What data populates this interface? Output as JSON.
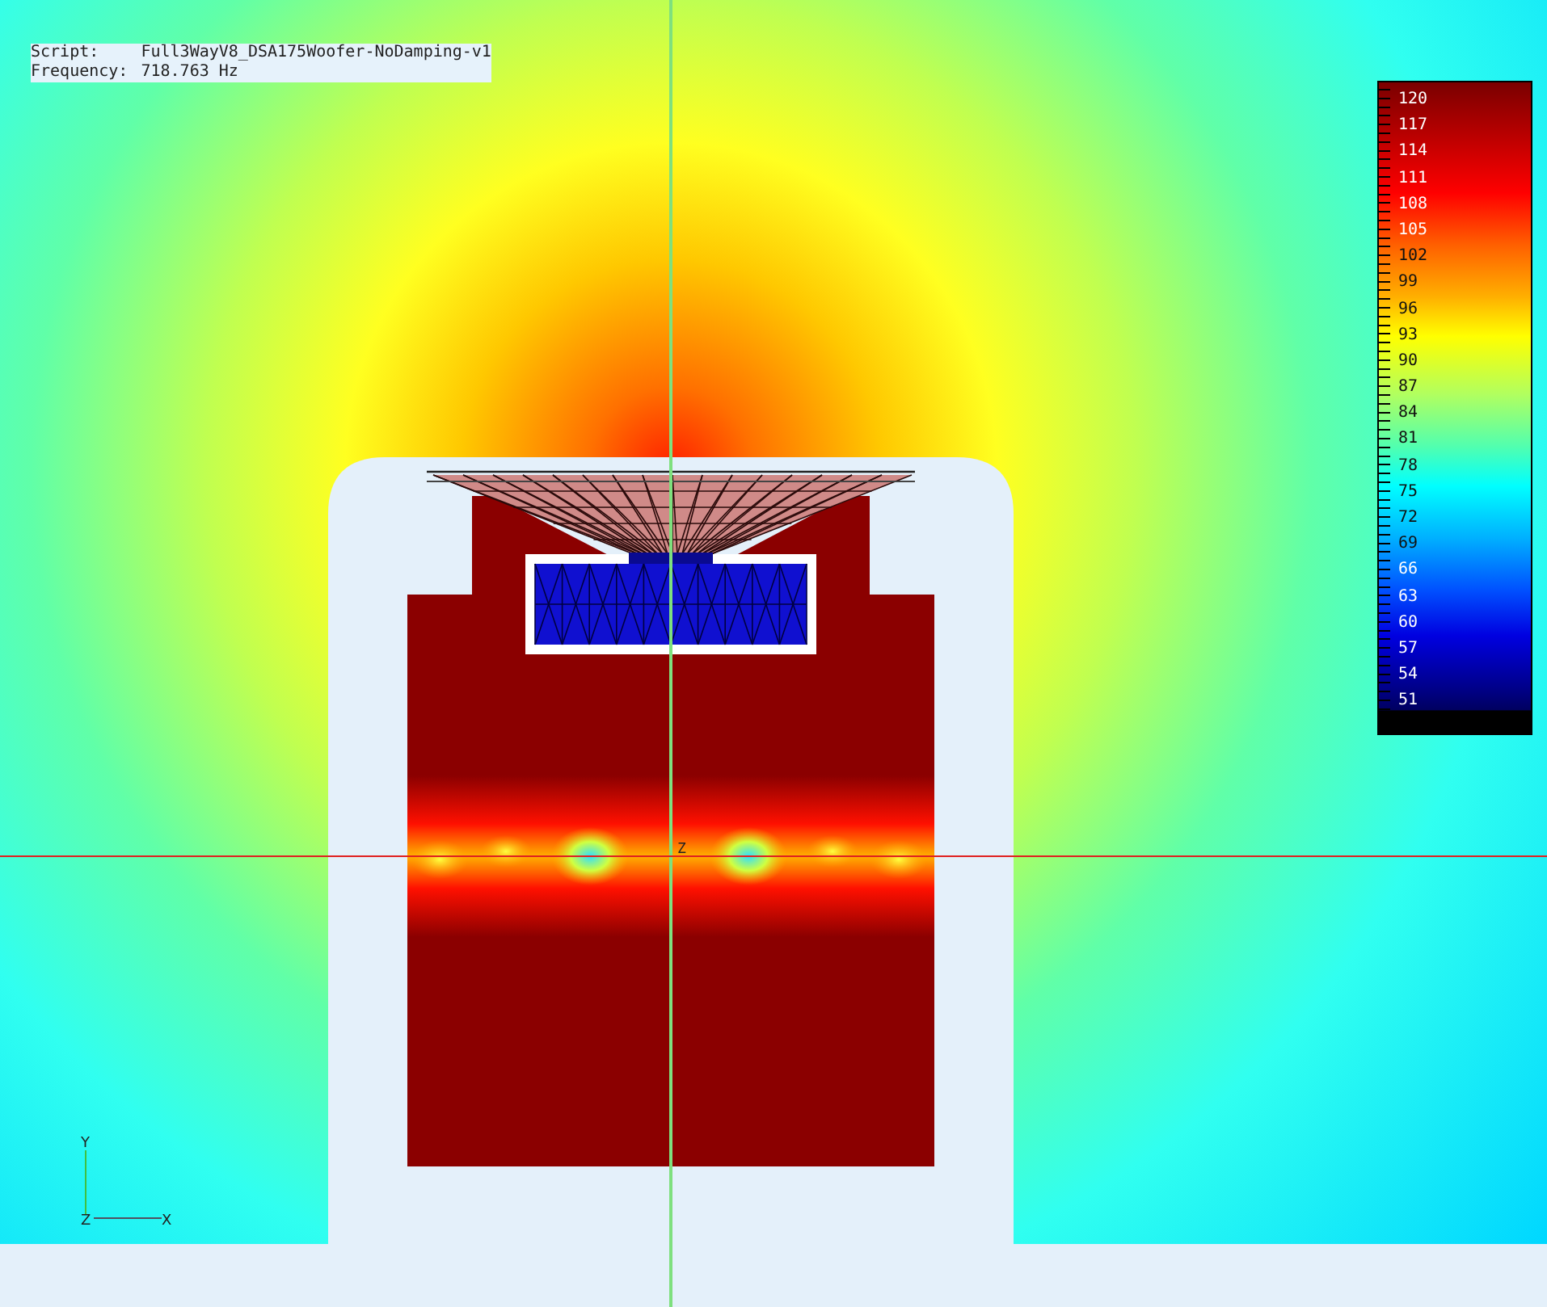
{
  "info": [
    {
      "label": "Script:",
      "value": "Full3WayV8_DSA175Woofer-NoDamping-v1"
    },
    {
      "label": "Frequency:",
      "value": "718.763 Hz"
    }
  ],
  "origin_label": "Z",
  "axes": {
    "y": "Y",
    "z": "Z",
    "x": "X"
  },
  "colorbar": {
    "labels": [
      "120",
      "117",
      "114",
      "111",
      "108",
      "105",
      "102",
      "99",
      "96",
      "93",
      "90",
      "87",
      "84",
      "81",
      "78",
      "75",
      "72",
      "69",
      "66",
      "63",
      "60",
      "57",
      "54",
      "51"
    ]
  }
}
